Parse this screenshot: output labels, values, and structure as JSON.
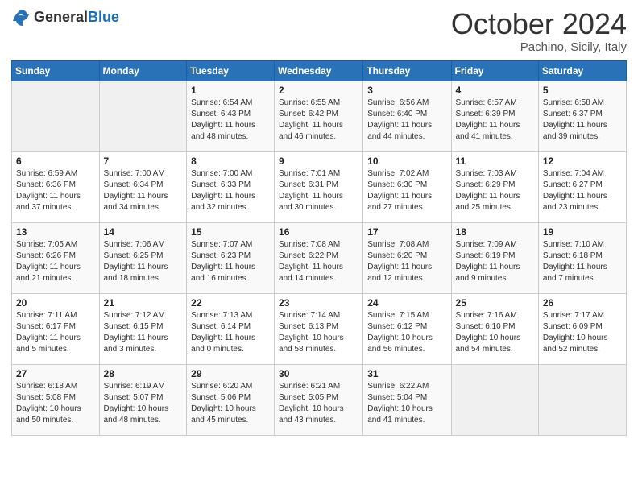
{
  "header": {
    "logo_general": "General",
    "logo_blue": "Blue",
    "month": "October 2024",
    "location": "Pachino, Sicily, Italy"
  },
  "weekdays": [
    "Sunday",
    "Monday",
    "Tuesday",
    "Wednesday",
    "Thursday",
    "Friday",
    "Saturday"
  ],
  "weeks": [
    [
      {
        "day": "",
        "sunrise": "",
        "sunset": "",
        "daylight": ""
      },
      {
        "day": "",
        "sunrise": "",
        "sunset": "",
        "daylight": ""
      },
      {
        "day": "1",
        "sunrise": "Sunrise: 6:54 AM",
        "sunset": "Sunset: 6:43 PM",
        "daylight": "Daylight: 11 hours and 48 minutes."
      },
      {
        "day": "2",
        "sunrise": "Sunrise: 6:55 AM",
        "sunset": "Sunset: 6:42 PM",
        "daylight": "Daylight: 11 hours and 46 minutes."
      },
      {
        "day": "3",
        "sunrise": "Sunrise: 6:56 AM",
        "sunset": "Sunset: 6:40 PM",
        "daylight": "Daylight: 11 hours and 44 minutes."
      },
      {
        "day": "4",
        "sunrise": "Sunrise: 6:57 AM",
        "sunset": "Sunset: 6:39 PM",
        "daylight": "Daylight: 11 hours and 41 minutes."
      },
      {
        "day": "5",
        "sunrise": "Sunrise: 6:58 AM",
        "sunset": "Sunset: 6:37 PM",
        "daylight": "Daylight: 11 hours and 39 minutes."
      }
    ],
    [
      {
        "day": "6",
        "sunrise": "Sunrise: 6:59 AM",
        "sunset": "Sunset: 6:36 PM",
        "daylight": "Daylight: 11 hours and 37 minutes."
      },
      {
        "day": "7",
        "sunrise": "Sunrise: 7:00 AM",
        "sunset": "Sunset: 6:34 PM",
        "daylight": "Daylight: 11 hours and 34 minutes."
      },
      {
        "day": "8",
        "sunrise": "Sunrise: 7:00 AM",
        "sunset": "Sunset: 6:33 PM",
        "daylight": "Daylight: 11 hours and 32 minutes."
      },
      {
        "day": "9",
        "sunrise": "Sunrise: 7:01 AM",
        "sunset": "Sunset: 6:31 PM",
        "daylight": "Daylight: 11 hours and 30 minutes."
      },
      {
        "day": "10",
        "sunrise": "Sunrise: 7:02 AM",
        "sunset": "Sunset: 6:30 PM",
        "daylight": "Daylight: 11 hours and 27 minutes."
      },
      {
        "day": "11",
        "sunrise": "Sunrise: 7:03 AM",
        "sunset": "Sunset: 6:29 PM",
        "daylight": "Daylight: 11 hours and 25 minutes."
      },
      {
        "day": "12",
        "sunrise": "Sunrise: 7:04 AM",
        "sunset": "Sunset: 6:27 PM",
        "daylight": "Daylight: 11 hours and 23 minutes."
      }
    ],
    [
      {
        "day": "13",
        "sunrise": "Sunrise: 7:05 AM",
        "sunset": "Sunset: 6:26 PM",
        "daylight": "Daylight: 11 hours and 21 minutes."
      },
      {
        "day": "14",
        "sunrise": "Sunrise: 7:06 AM",
        "sunset": "Sunset: 6:25 PM",
        "daylight": "Daylight: 11 hours and 18 minutes."
      },
      {
        "day": "15",
        "sunrise": "Sunrise: 7:07 AM",
        "sunset": "Sunset: 6:23 PM",
        "daylight": "Daylight: 11 hours and 16 minutes."
      },
      {
        "day": "16",
        "sunrise": "Sunrise: 7:08 AM",
        "sunset": "Sunset: 6:22 PM",
        "daylight": "Daylight: 11 hours and 14 minutes."
      },
      {
        "day": "17",
        "sunrise": "Sunrise: 7:08 AM",
        "sunset": "Sunset: 6:20 PM",
        "daylight": "Daylight: 11 hours and 12 minutes."
      },
      {
        "day": "18",
        "sunrise": "Sunrise: 7:09 AM",
        "sunset": "Sunset: 6:19 PM",
        "daylight": "Daylight: 11 hours and 9 minutes."
      },
      {
        "day": "19",
        "sunrise": "Sunrise: 7:10 AM",
        "sunset": "Sunset: 6:18 PM",
        "daylight": "Daylight: 11 hours and 7 minutes."
      }
    ],
    [
      {
        "day": "20",
        "sunrise": "Sunrise: 7:11 AM",
        "sunset": "Sunset: 6:17 PM",
        "daylight": "Daylight: 11 hours and 5 minutes."
      },
      {
        "day": "21",
        "sunrise": "Sunrise: 7:12 AM",
        "sunset": "Sunset: 6:15 PM",
        "daylight": "Daylight: 11 hours and 3 minutes."
      },
      {
        "day": "22",
        "sunrise": "Sunrise: 7:13 AM",
        "sunset": "Sunset: 6:14 PM",
        "daylight": "Daylight: 11 hours and 0 minutes."
      },
      {
        "day": "23",
        "sunrise": "Sunrise: 7:14 AM",
        "sunset": "Sunset: 6:13 PM",
        "daylight": "Daylight: 10 hours and 58 minutes."
      },
      {
        "day": "24",
        "sunrise": "Sunrise: 7:15 AM",
        "sunset": "Sunset: 6:12 PM",
        "daylight": "Daylight: 10 hours and 56 minutes."
      },
      {
        "day": "25",
        "sunrise": "Sunrise: 7:16 AM",
        "sunset": "Sunset: 6:10 PM",
        "daylight": "Daylight: 10 hours and 54 minutes."
      },
      {
        "day": "26",
        "sunrise": "Sunrise: 7:17 AM",
        "sunset": "Sunset: 6:09 PM",
        "daylight": "Daylight: 10 hours and 52 minutes."
      }
    ],
    [
      {
        "day": "27",
        "sunrise": "Sunrise: 6:18 AM",
        "sunset": "Sunset: 5:08 PM",
        "daylight": "Daylight: 10 hours and 50 minutes."
      },
      {
        "day": "28",
        "sunrise": "Sunrise: 6:19 AM",
        "sunset": "Sunset: 5:07 PM",
        "daylight": "Daylight: 10 hours and 48 minutes."
      },
      {
        "day": "29",
        "sunrise": "Sunrise: 6:20 AM",
        "sunset": "Sunset: 5:06 PM",
        "daylight": "Daylight: 10 hours and 45 minutes."
      },
      {
        "day": "30",
        "sunrise": "Sunrise: 6:21 AM",
        "sunset": "Sunset: 5:05 PM",
        "daylight": "Daylight: 10 hours and 43 minutes."
      },
      {
        "day": "31",
        "sunrise": "Sunrise: 6:22 AM",
        "sunset": "Sunset: 5:04 PM",
        "daylight": "Daylight: 10 hours and 41 minutes."
      },
      {
        "day": "",
        "sunrise": "",
        "sunset": "",
        "daylight": ""
      },
      {
        "day": "",
        "sunrise": "",
        "sunset": "",
        "daylight": ""
      }
    ]
  ]
}
